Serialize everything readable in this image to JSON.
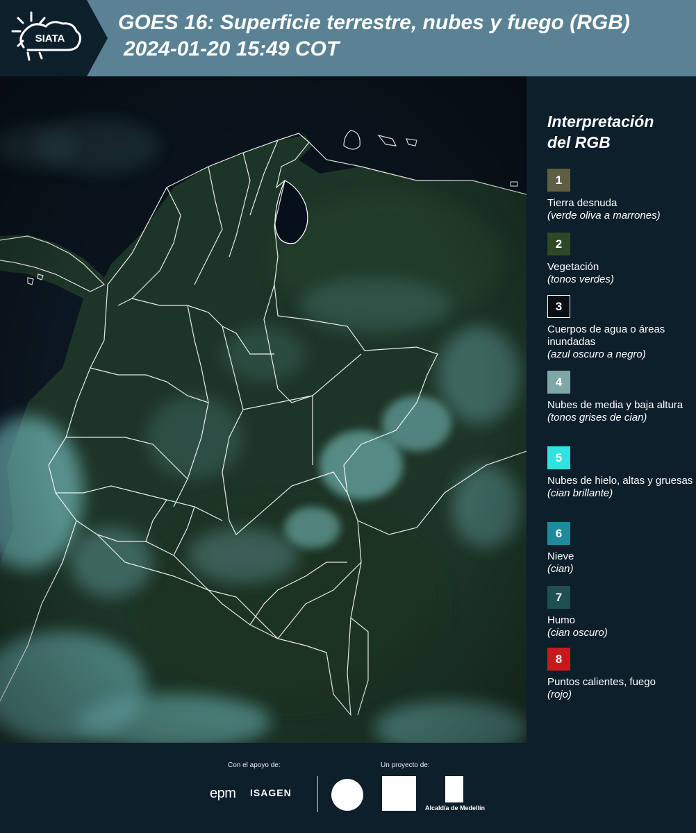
{
  "header": {
    "logo_text": "SIATA",
    "title_line1": "GOES 16: Superficie terrestre, nubes y fuego (RGB)",
    "title_line2": "2024-01-20 15:49 COT"
  },
  "map": {
    "land_color": "#1d3527",
    "ocean_color": "#0c1620",
    "cloud_color": "#7fd3d6",
    "border_color": "#ffffff"
  },
  "legend": {
    "title_line1": "Interpretación",
    "title_line2": "del RGB",
    "items": [
      {
        "number": "1",
        "label": "Tierra desnuda",
        "sub": "(verde oliva a marrones)",
        "color": "#5e5e45"
      },
      {
        "number": "2",
        "label": "Vegetación",
        "sub": "(tonos verdes)",
        "color": "#2e4726"
      },
      {
        "number": "3",
        "label": "Cuerpos de agua o áreas inundadas",
        "sub": "(azul oscuro a negro)",
        "color": "#0a0f14"
      },
      {
        "number": "4",
        "label": "Nubes de media y baja altura",
        "sub": "(tonos grises de cian)",
        "color": "#7ea7a8"
      },
      {
        "number": "5",
        "label": "Nubes de hielo, altas y gruesas",
        "sub": "(cian brillante)",
        "color": "#2fe3e0"
      },
      {
        "number": "6",
        "label": "Nieve",
        "sub": "(cian)",
        "color": "#20899c"
      },
      {
        "number": "7",
        "label": "Humo",
        "sub": "(cian oscuro)",
        "color": "#1f4f51"
      },
      {
        "number": "8",
        "label": "Puntos calientes, fuego",
        "sub": "(rojo)",
        "color": "#c8181c"
      }
    ]
  },
  "footer": {
    "support_label": "Con el apoyo de:",
    "project_label": "Un proyecto de:",
    "sponsor1": "epm",
    "sponsor2": "ISAGEN",
    "partner3": "Alcaldía de Medellín"
  }
}
